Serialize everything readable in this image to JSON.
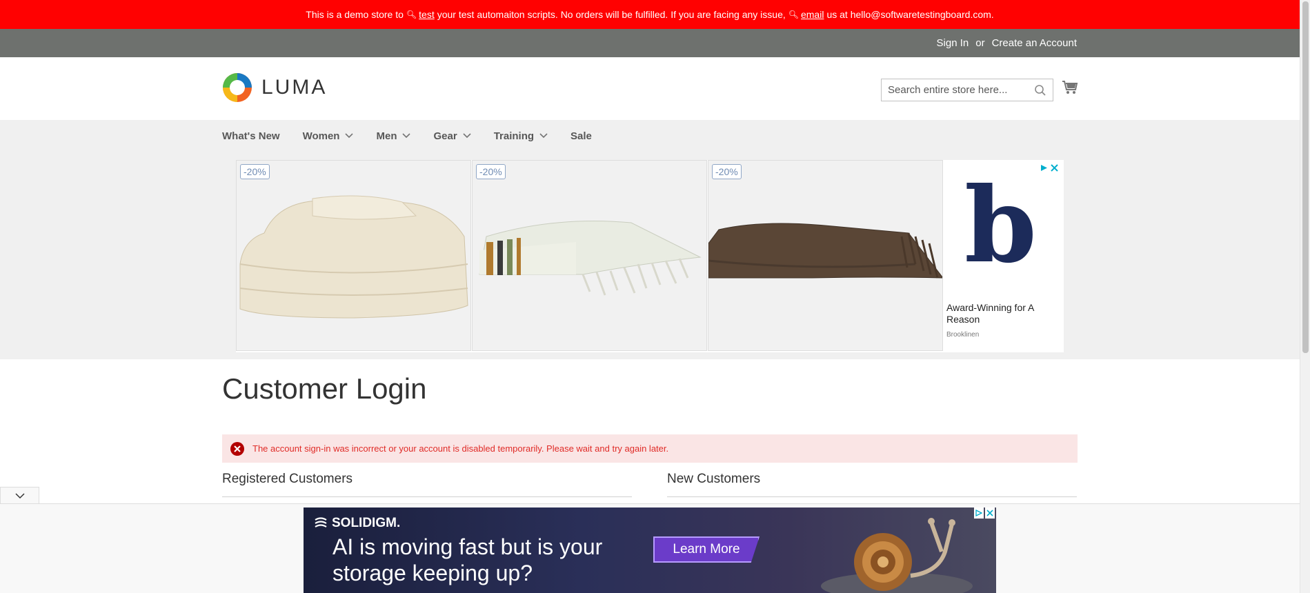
{
  "notice": {
    "part1": "This is a demo store to",
    "link1": "test",
    "part2": "your test automaiton scripts. No orders will be fulfilled. If you are facing any issue,",
    "link2": "email",
    "part3": "us at hello@softwaretestingboard.com."
  },
  "header": {
    "sign_in": "Sign In",
    "or": "or",
    "create_account": "Create an Account",
    "logo_text": "LUMA",
    "search_placeholder": "Search entire store here..."
  },
  "nav": {
    "items": [
      {
        "label": "What's New",
        "dropdown": false
      },
      {
        "label": "Women",
        "dropdown": true
      },
      {
        "label": "Men",
        "dropdown": true
      },
      {
        "label": "Gear",
        "dropdown": true
      },
      {
        "label": "Training",
        "dropdown": true
      },
      {
        "label": "Sale",
        "dropdown": false
      }
    ]
  },
  "ad": {
    "badges": [
      "-20%",
      "-20%",
      "-20%"
    ],
    "side_logo": "b",
    "side_title": "Award-Winning for A Reason",
    "side_brand": "Brooklinen"
  },
  "main": {
    "page_title": "Customer Login",
    "error_message": "The account sign-in was incorrect or your account is disabled temporarily. Please wait and try again later.",
    "registered_title": "Registered Customers",
    "new_title": "New Customers"
  },
  "bottom_ad": {
    "brand": "SOLIDIGM.",
    "headline": "AI is moving fast but is your storage keeping up?",
    "cta": "Learn More"
  },
  "colors": {
    "notice_bg": "#ff0101",
    "panel_bg": "#6e716e",
    "nav_bg": "#f0f0f0",
    "error_bg": "#fae5e5",
    "error_text": "#e02b27"
  }
}
